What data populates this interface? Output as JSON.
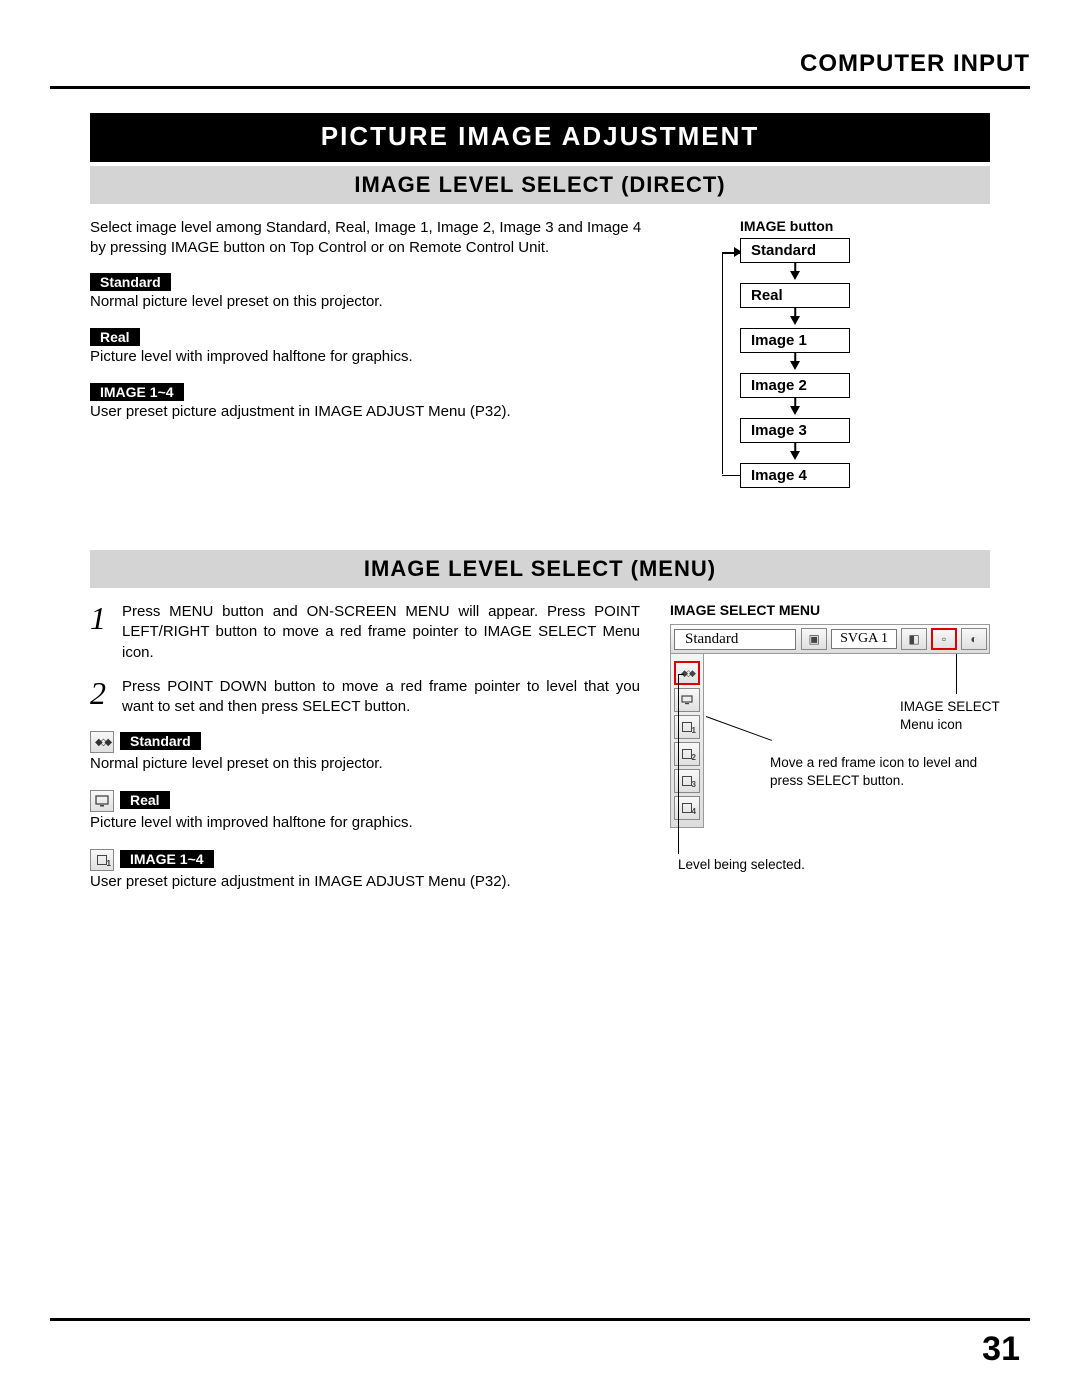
{
  "page": {
    "header": "COMPUTER INPUT",
    "title_bar": "PICTURE IMAGE ADJUSTMENT",
    "number": "31"
  },
  "direct": {
    "subtitle": "IMAGE LEVEL SELECT (DIRECT)",
    "intro": "Select image level among Standard, Real, Image 1, Image 2, Image 3 and Image 4 by pressing IMAGE button on Top Control or on Remote Control Unit.",
    "labels": {
      "standard": "Standard",
      "standard_desc": "Normal picture level preset on this projector.",
      "real": "Real",
      "real_desc": "Picture level with improved halftone for graphics.",
      "image14": "IMAGE 1~4",
      "image14_desc": "User preset picture adjustment in IMAGE ADJUST Menu (P32)."
    },
    "flow": {
      "title": "IMAGE button",
      "items": [
        "Standard",
        "Real",
        "Image 1",
        "Image 2",
        "Image 3",
        "Image 4"
      ]
    }
  },
  "menu": {
    "subtitle": "IMAGE LEVEL SELECT (MENU)",
    "steps": {
      "s1": "Press MENU button and ON-SCREEN MENU will appear.  Press POINT LEFT/RIGHT button to move a red frame pointer to IMAGE SELECT Menu icon.",
      "s2": "Press POINT DOWN button to move a red frame pointer to level that you want to set and then press SELECT button."
    },
    "labels": {
      "standard": "Standard",
      "standard_desc": "Normal picture level preset on this projector.",
      "real": "Real",
      "real_desc": "Picture level with improved halftone for graphics.",
      "image14": "IMAGE 1~4",
      "image14_desc": "User preset picture adjustment in IMAGE ADJUST Menu (P32)."
    },
    "mock": {
      "title": "IMAGE SELECT MENU",
      "bar_text": "Standard",
      "bar_svga": "SVGA 1",
      "callout_icon": "IMAGE SELECT Menu icon",
      "callout_move": "Move a red frame icon to level and press SELECT button.",
      "callout_level": "Level being selected."
    }
  }
}
